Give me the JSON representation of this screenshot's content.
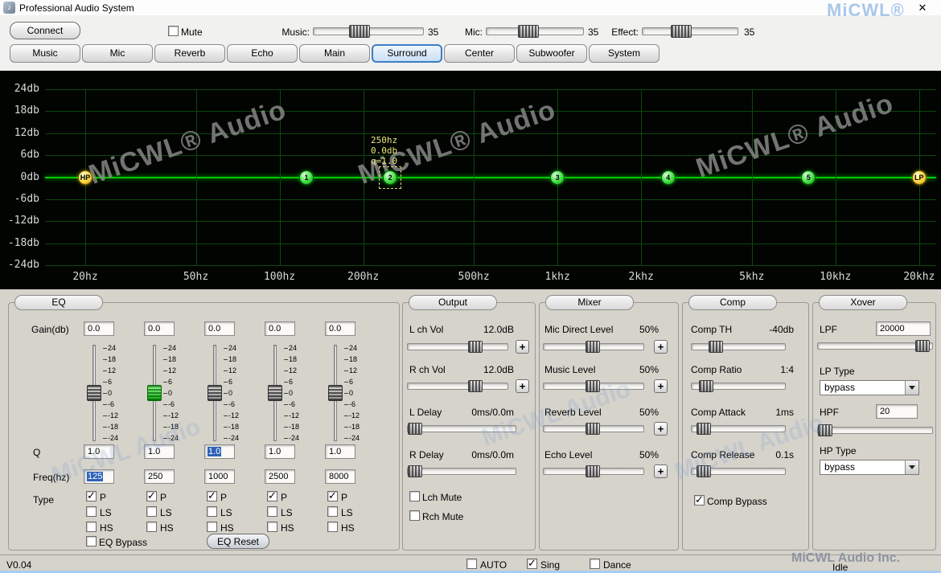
{
  "window": {
    "title": "Professional Audio System",
    "icon_glyph": "♪",
    "close_glyph": "✕",
    "brand_watermark": "MiCWL®"
  },
  "toolbar": {
    "connect_label": "Connect",
    "mute_label": "Mute",
    "mute_checked": false,
    "sliders": [
      {
        "label": "Music:",
        "value": "35",
        "percent": 40
      },
      {
        "label": "Mic:",
        "value": "35",
        "percent": 42
      },
      {
        "label": "Effect:",
        "value": "35",
        "percent": 38
      }
    ]
  },
  "tabs": {
    "items": [
      {
        "label": "Music",
        "active": false
      },
      {
        "label": "Mic",
        "active": false
      },
      {
        "label": "Reverb",
        "active": false
      },
      {
        "label": "Echo",
        "active": false
      },
      {
        "label": "Main",
        "active": false
      },
      {
        "label": "Surround",
        "active": true
      },
      {
        "label": "Center",
        "active": false
      },
      {
        "label": "Subwoofer",
        "active": false
      },
      {
        "label": "System",
        "active": false
      }
    ]
  },
  "graph": {
    "watermark": "MiCWL® Audio",
    "y_labels": [
      "24db",
      "18db",
      "12db",
      "6db",
      "0db",
      "-6db",
      "-12db",
      "-18db",
      "-24db"
    ],
    "x_labels": [
      "20hz",
      "50hz",
      "100hz",
      "200hz",
      "500hz",
      "1khz",
      "2khz",
      "5khz",
      "10khz",
      "20khz"
    ],
    "x_freqs": [
      20,
      50,
      100,
      200,
      500,
      1000,
      2000,
      5000,
      10000,
      20000
    ],
    "points": [
      {
        "label": "HP",
        "freq": 20,
        "db": 0,
        "style": "yellow",
        "selected": false
      },
      {
        "label": "1",
        "freq": 125,
        "db": 0,
        "style": "green",
        "selected": false
      },
      {
        "label": "2",
        "freq": 250,
        "db": 0,
        "style": "green",
        "selected": true
      },
      {
        "label": "3",
        "freq": 1000,
        "db": 0,
        "style": "green",
        "selected": false
      },
      {
        "label": "4",
        "freq": 2500,
        "db": 0,
        "style": "green",
        "selected": false
      },
      {
        "label": "5",
        "freq": 8000,
        "db": 0,
        "style": "green",
        "selected": false
      },
      {
        "label": "LP",
        "freq": 20000,
        "db": 0,
        "style": "yellow",
        "selected": false
      }
    ],
    "tooltip": [
      "250hz",
      "0.0db",
      "q=1.0"
    ]
  },
  "eq": {
    "legend": "EQ",
    "gain_label": "Gain(db)",
    "q_label": "Q",
    "freq_label": "Freq(hz)",
    "type_label": "Type",
    "scale": [
      "24",
      "18",
      "12",
      "6",
      "0",
      "-6",
      "-12",
      "-18",
      "-24"
    ],
    "bands": [
      {
        "gain": "0.0",
        "q": "1.0",
        "freq": "125",
        "selected": false,
        "q_selected": false,
        "freq_selected": true,
        "types": [
          {
            "label": "P",
            "checked": true
          },
          {
            "label": "LS",
            "checked": false
          },
          {
            "label": "HS",
            "checked": false
          }
        ]
      },
      {
        "gain": "0.0",
        "q": "1.0",
        "freq": "250",
        "selected": true,
        "q_selected": false,
        "freq_selected": false,
        "types": [
          {
            "label": "P",
            "checked": true
          },
          {
            "label": "LS",
            "checked": false
          },
          {
            "label": "HS",
            "checked": false
          }
        ]
      },
      {
        "gain": "0.0",
        "q": "1.0",
        "freq": "1000",
        "selected": false,
        "q_selected": true,
        "freq_selected": false,
        "types": [
          {
            "label": "P",
            "checked": true
          },
          {
            "label": "LS",
            "checked": false
          },
          {
            "label": "HS",
            "checked": false
          }
        ]
      },
      {
        "gain": "0.0",
        "q": "1.0",
        "freq": "2500",
        "selected": false,
        "q_selected": false,
        "freq_selected": false,
        "types": [
          {
            "label": "P",
            "checked": true
          },
          {
            "label": "LS",
            "checked": false
          },
          {
            "label": "HS",
            "checked": false
          }
        ]
      },
      {
        "gain": "0.0",
        "q": "1.0",
        "freq": "8000",
        "selected": false,
        "q_selected": false,
        "freq_selected": false,
        "types": [
          {
            "label": "P",
            "checked": true
          },
          {
            "label": "LS",
            "checked": false
          },
          {
            "label": "HS",
            "checked": false
          }
        ]
      }
    ],
    "bypass_label": "EQ Bypass",
    "bypass_checked": false,
    "reset_label": "EQ Reset"
  },
  "ui": {
    "plus_label": "+"
  },
  "output": {
    "legend": "Output",
    "rows": [
      {
        "label": "L ch Vol",
        "value": "12.0dB",
        "percent": 72,
        "plus": true
      },
      {
        "label": "R ch Vol",
        "value": "12.0dB",
        "percent": 72,
        "plus": true
      },
      {
        "label": "L Delay",
        "value": "0ms/0.0m",
        "percent": 1,
        "plus": false
      },
      {
        "label": "R Delay",
        "value": "0ms/0.0m",
        "percent": 1,
        "plus": false
      }
    ],
    "mutes": [
      {
        "label": "Lch Mute",
        "checked": false
      },
      {
        "label": "Rch Mute",
        "checked": false
      }
    ]
  },
  "mixer": {
    "legend": "Mixer",
    "rows": [
      {
        "label": "Mic Direct Level",
        "value": "50%",
        "percent": 50,
        "plus": true
      },
      {
        "label": "Music Level",
        "value": "50%",
        "percent": 50,
        "plus": true
      },
      {
        "label": "Reverb Level",
        "value": "50%",
        "percent": 50,
        "plus": true
      },
      {
        "label": "Echo Level",
        "value": "50%",
        "percent": 50,
        "plus": true
      }
    ]
  },
  "comp": {
    "legend": "Comp",
    "rows": [
      {
        "label": "Comp TH",
        "value": "-40db",
        "percent": 22,
        "plus": false
      },
      {
        "label": "Comp Ratio",
        "value": "1:4",
        "percent": 10,
        "plus": false
      },
      {
        "label": "Comp Attack",
        "value": "1ms",
        "percent": 7,
        "plus": false
      },
      {
        "label": "Comp Release",
        "value": "0.1s",
        "percent": 7,
        "plus": false
      }
    ],
    "bypass_label": "Comp Bypass",
    "bypass_checked": true
  },
  "xover": {
    "legend": "Xover",
    "lpf_label": "LPF",
    "lpf_value": "20000",
    "lpf_percent": 97,
    "lp_type_label": "LP Type",
    "lp_type_value": "bypass",
    "hpf_label": "HPF",
    "hpf_value": "20",
    "hpf_percent": 1,
    "hp_type_label": "HP Type",
    "hp_type_value": "bypass"
  },
  "statusbar": {
    "version": "V0.04",
    "checks": [
      {
        "label": "AUTO",
        "checked": false
      },
      {
        "label": "Sing",
        "checked": true
      },
      {
        "label": "Dance",
        "checked": false
      }
    ],
    "status": "Idle",
    "company_watermark": "MiCWL Audio Inc."
  },
  "panel_watermark": "MiCWL Audio"
}
